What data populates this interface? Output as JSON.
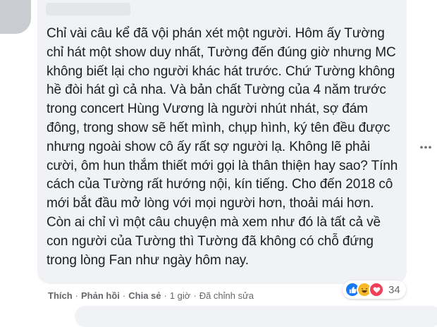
{
  "comment": {
    "text": "Chỉ vài câu kể đã vội phán xét một người. Hôm ấy Tường chỉ hát một show duy nhất, Tường đến đúng giờ nhưng MC không biết lại cho người khác hát trước. Chứ Tường không hề đòi hát gì cả nha. Và bản chất Tường của 4 năm trước trong concert Hùng Vương là người nhút nhát, sợ đám đông, trong show sẽ hết mình, chụp hình, ký tên đều được nhưng ngoài show cô ấy rất sợ người lạ. Không lẽ phải cười, ôm hun thắm thiết mới gọi là thân thiện hay sao? Tính cách của Tường rất hướng nội, kín tiếng. Cho đến 2018 cô mới bắt đầu mở lòng với mọi người hơn, thoải mái hơn. Còn ai chỉ vì một câu chuyện mà xem như đó là tất cả về con người của Tường thì Tường đã không có chỗ đứng trong lòng Fan như ngày hôm nay."
  },
  "actions": {
    "like": "Thích",
    "reply": "Phản hồi",
    "share": "Chia sẻ",
    "time": "1 giờ",
    "edited": "Đã chỉnh sửa",
    "separator": "·"
  },
  "reactions": {
    "count": "34",
    "icons": [
      "like-icon",
      "haha-icon",
      "love-icon"
    ],
    "colors": {
      "like": "#1877f2",
      "haha": "#f7b928",
      "love": "#f33e58"
    }
  },
  "more_icon": "ellipsis-icon"
}
